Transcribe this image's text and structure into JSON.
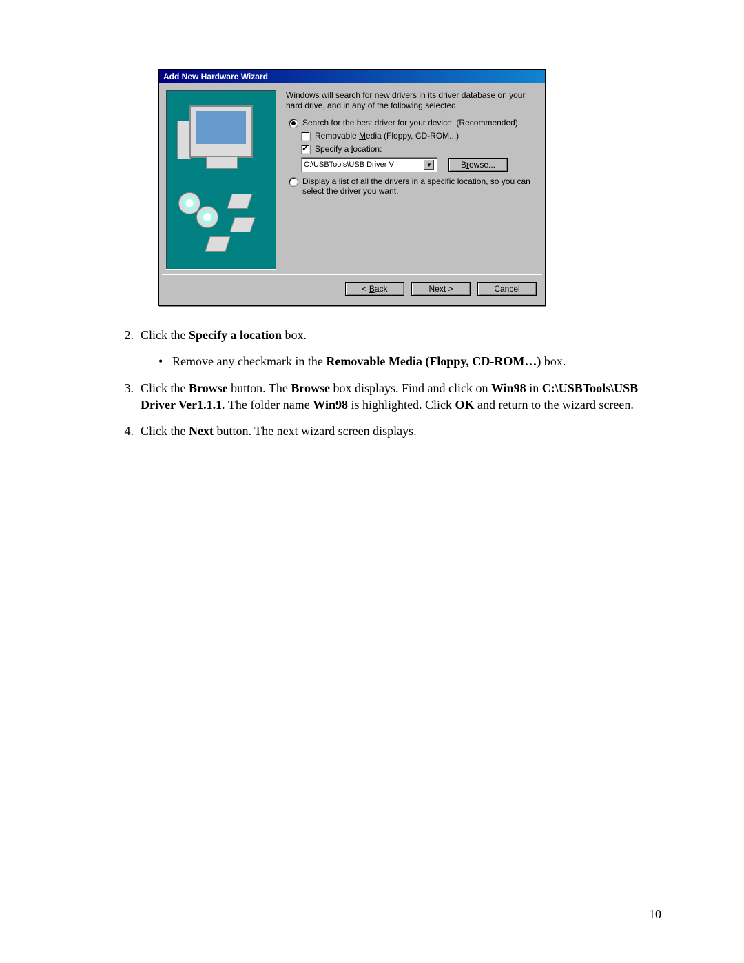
{
  "dialog": {
    "title": "Add New Hardware Wizard",
    "intro": "Windows will search for new drivers in its driver database on your hard drive, and in any of the following selected",
    "radio_search": "Search for the best driver for your device. (Recommended).",
    "chk_removable_pre": "Removable ",
    "chk_removable_u": "M",
    "chk_removable_post": "edia (Floppy, CD-ROM...)",
    "chk_specify_pre": "Specify a ",
    "chk_specify_u": "l",
    "chk_specify_post": "ocation:",
    "path_value": "C:\\USBTools\\USB Driver V",
    "browse_pre": "B",
    "browse_u": "r",
    "browse_post": "owse...",
    "radio_list_u": "D",
    "radio_list_post": "isplay a list of all the drivers in a specific location, so you can select the driver you want.",
    "back_pre": "< ",
    "back_u": "B",
    "back_post": "ack",
    "next": "Next >",
    "cancel": "Cancel"
  },
  "steps": {
    "s2_pre": "Click the ",
    "s2_b": "Specify a location",
    "s2_post": " box.",
    "bullet_pre": "Remove any checkmark in the ",
    "bullet_b": "Removable Media (Floppy, CD-ROM…)",
    "bullet_post": " box.",
    "s3_a": "Click the ",
    "s3_b1": "Browse",
    "s3_c": " button.  The ",
    "s3_b2": "Browse",
    "s3_d": " box displays.  Find and click on ",
    "s3_b3": "Win98",
    "s3_e": " in ",
    "s3_b4": "C:\\USBTools\\USB Driver Ver1.1.1",
    "s3_f": ".  The folder name ",
    "s3_b5": "Win98",
    "s3_g": " is highlighted.  Click ",
    "s3_b6": "OK",
    "s3_h": " and return to the wizard screen.",
    "s4_a": "Click the ",
    "s4_b": "Next",
    "s4_c": " button.  The next wizard screen displays."
  },
  "page_number": "10"
}
